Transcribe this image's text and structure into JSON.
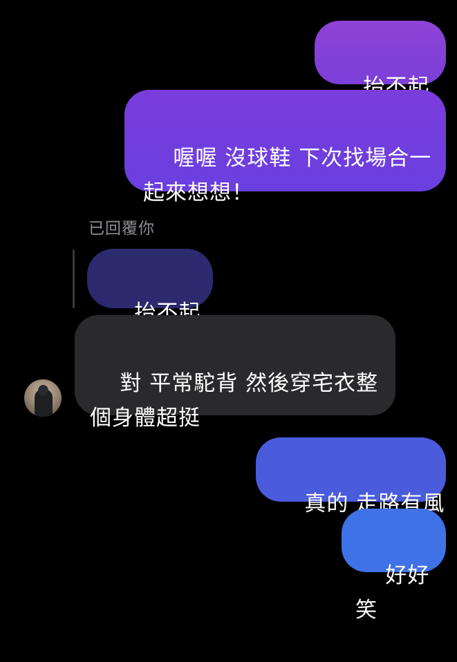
{
  "messages": [
    {
      "id": "msg1",
      "sender": "me",
      "text": "抬不起頭"
    },
    {
      "id": "msg2",
      "sender": "me",
      "text": "喔喔 沒球鞋 下次找場合一\n起來想想！"
    },
    {
      "id": "msg3",
      "sender": "them",
      "text": "對 平常駝背 然後穿宅衣整\n個身體超挺",
      "reply_label": "已回覆你",
      "quoted_text": "抬不起頭"
    },
    {
      "id": "msg4",
      "sender": "me",
      "text": "真的 走路有風"
    },
    {
      "id": "msg5",
      "sender": "me",
      "text": "好好笑"
    }
  ],
  "colors": {
    "background": "#000000",
    "outgoing_purple": "#7b3fd8",
    "outgoing_blue": "#4a5cdc",
    "incoming": "#2a2a2c",
    "quoted": "#2c2a6e",
    "meta_text": "#8e8e93"
  }
}
